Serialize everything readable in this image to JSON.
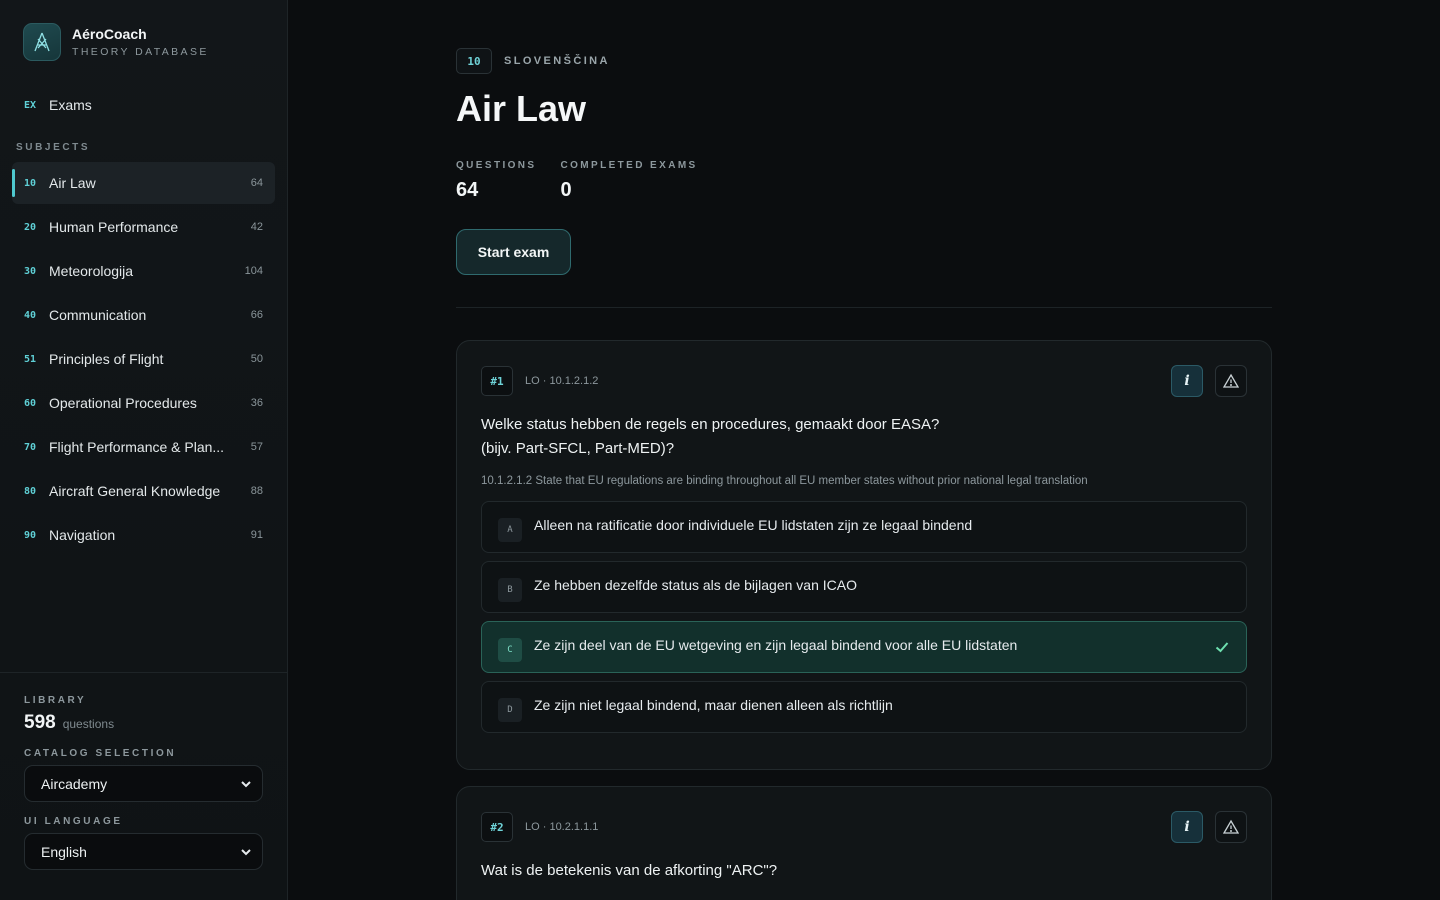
{
  "brand": {
    "name": "AéroCoach",
    "subtitle": "THEORY DATABASE"
  },
  "nav": {
    "exams": {
      "code": "EX",
      "label": "Exams"
    }
  },
  "subjects_title": "SUBJECTS",
  "subjects": [
    {
      "code": "10",
      "label": "Air Law",
      "count": "64",
      "active": true
    },
    {
      "code": "20",
      "label": "Human Performance",
      "count": "42"
    },
    {
      "code": "30",
      "label": "Meteorologija",
      "count": "104"
    },
    {
      "code": "40",
      "label": "Communication",
      "count": "66"
    },
    {
      "code": "51",
      "label": "Principles of Flight",
      "count": "50"
    },
    {
      "code": "60",
      "label": "Operational Procedures",
      "count": "36"
    },
    {
      "code": "70",
      "label": "Flight Performance & Plan...",
      "count": "57"
    },
    {
      "code": "80",
      "label": "Aircraft General Knowledge",
      "count": "88"
    },
    {
      "code": "90",
      "label": "Navigation",
      "count": "91"
    }
  ],
  "footer": {
    "library_label": "LIBRARY",
    "library_count": "598",
    "library_unit": "questions",
    "catalog_label": "CATALOG SELECTION",
    "catalog_value": "Aircademy",
    "language_label": "UI LANGUAGE",
    "language_value": "English"
  },
  "header": {
    "code": "10",
    "language": "SLOVENŠČINA",
    "title": "Air Law",
    "stats": [
      {
        "label": "QUESTIONS",
        "value": "64"
      },
      {
        "label": "COMPLETED EXAMS",
        "value": "0"
      }
    ],
    "start_button": "Start exam"
  },
  "questions": [
    {
      "number": "#1",
      "lo": "LO · 10.1.2.1.2",
      "text_line1": "Welke status hebben de regels en procedures, gemaakt door EASA?",
      "text_line2": "(bijv. Part-SFCL, Part-MED)?",
      "description": "10.1.2.1.2 State that EU regulations are binding throughout all EU member states without prior national legal translation",
      "answers": [
        {
          "letter": "A",
          "text": "Alleen na ratificatie door individuele EU lidstaten zijn ze legaal bindend"
        },
        {
          "letter": "B",
          "text": "Ze hebben dezelfde status als de bijlagen van ICAO"
        },
        {
          "letter": "C",
          "text": "Ze zijn deel van de EU wetgeving en zijn legaal bindend voor alle EU lidstaten",
          "correct": true
        },
        {
          "letter": "D",
          "text": "Ze zijn niet legaal bindend, maar dienen alleen als richtlijn"
        }
      ]
    },
    {
      "number": "#2",
      "lo": "LO · 10.2.1.1.1",
      "text_line1": "Wat is de betekenis van de afkorting \"ARC\"?"
    }
  ],
  "icons": {
    "info": "i",
    "warning": "warning-icon",
    "check": "check-icon",
    "chevron": "chevron-down-icon"
  },
  "colors": {
    "accent": "#4fc9cf",
    "correct": "#2a6358",
    "background": "#0b0d0f"
  }
}
